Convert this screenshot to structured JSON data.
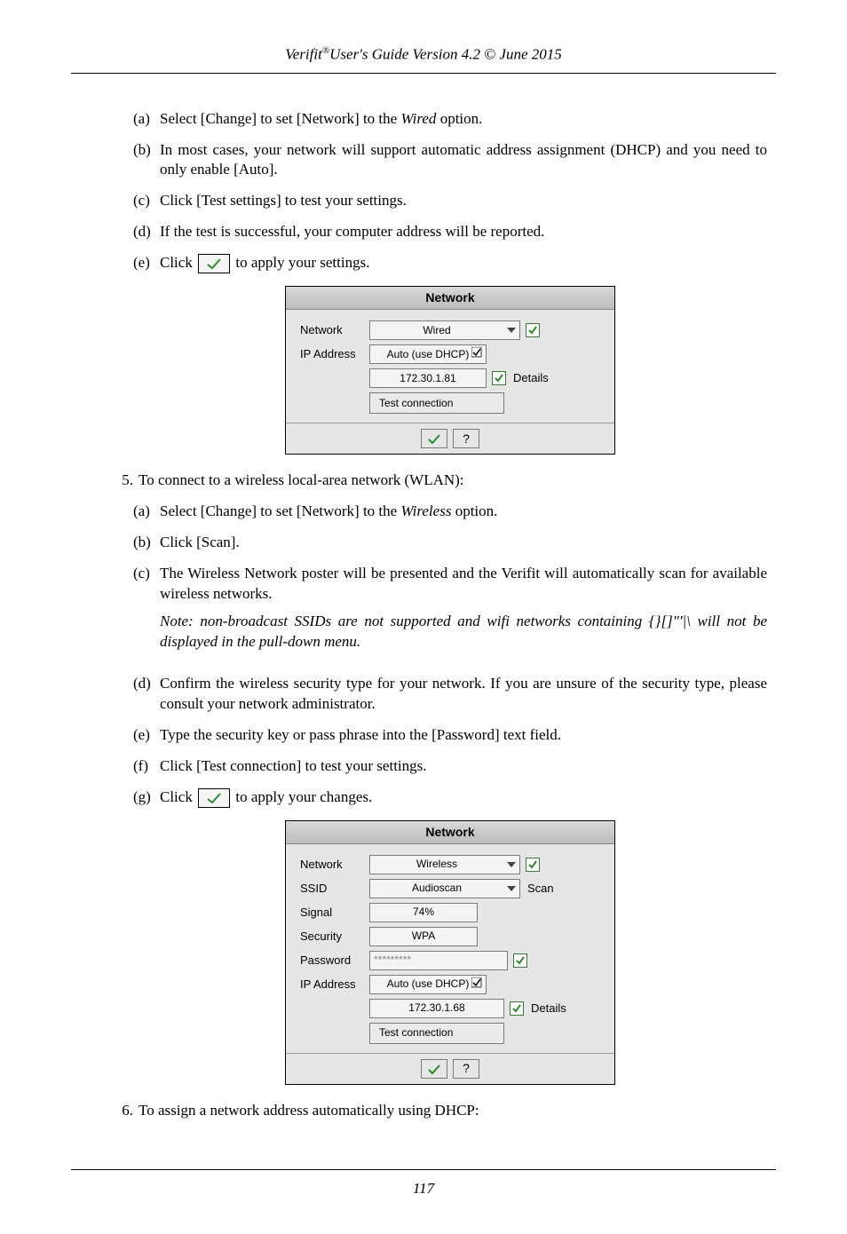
{
  "header": {
    "product": "Verifit",
    "reg": "®",
    "rest": "User's Guide Version 4.2 © June 2015"
  },
  "section4": {
    "a": {
      "m": "(a)",
      "pre": "Select [Change] to set  [Network] to the ",
      "it": "Wired",
      "post": " option."
    },
    "b": {
      "m": "(b)",
      "t": "In most cases, your network will support automatic address assignment (DHCP) and you need to only enable [Auto]."
    },
    "c": {
      "m": "(c)",
      "t": "Click [Test settings] to test your settings."
    },
    "d": {
      "m": "(d)",
      "t": "If the test is successful, your computer address will be reported."
    },
    "e": {
      "m": "(e)",
      "pre": "Click ",
      "post": " to apply your settings."
    }
  },
  "dialog1": {
    "title": "Network",
    "rows": {
      "network": {
        "label": "Network",
        "value": "Wired"
      },
      "ip": {
        "label": "IP Address",
        "value": "Auto (use DHCP)"
      },
      "ipval": {
        "value": "172.30.1.81",
        "details": "Details"
      },
      "test": "Test connection"
    },
    "help": "?"
  },
  "step5": {
    "num": "5.",
    "t": "To connect to a wireless local-area network (WLAN):",
    "a": {
      "m": "(a)",
      "pre": "Select [Change] to set  [Network] to the ",
      "it": "Wireless",
      "post": " option."
    },
    "b": {
      "m": "(b)",
      "t": "Click [Scan]."
    },
    "c": {
      "m": "(c)",
      "t": "The Wireless Network poster will be presented and the Verifit will automatically scan for available wireless networks."
    },
    "note": "Note: non-broadcast SSIDs are not supported and wifi networks containing {}[]\"'|\\ will not be displayed in the pull-down menu.",
    "d": {
      "m": "(d)",
      "t": "Confirm the wireless security type for your network. If you are unsure of the security type, please consult your network administrator."
    },
    "e": {
      "m": "(e)",
      "t": "Type the security key or pass phrase into the [Password] text field."
    },
    "f": {
      "m": "(f)",
      "t": "Click [Test connection] to test your settings."
    },
    "g": {
      "m": "(g)",
      "pre": "Click ",
      "post": " to apply your changes."
    }
  },
  "dialog2": {
    "title": "Network",
    "rows": {
      "network": {
        "label": "Network",
        "value": "Wireless"
      },
      "ssid": {
        "label": "SSID",
        "value": "Audioscan",
        "scan": "Scan"
      },
      "signal": {
        "label": "Signal",
        "value": "74%"
      },
      "security": {
        "label": "Security",
        "value": "WPA"
      },
      "password": {
        "label": "Password",
        "value": "*********"
      },
      "ip": {
        "label": "IP Address",
        "value": "Auto (use DHCP)"
      },
      "ipval": {
        "value": "172.30.1.68",
        "details": "Details"
      },
      "test": "Test connection"
    },
    "help": "?"
  },
  "step6": {
    "num": "6.",
    "t": "To assign a network address automatically using DHCP:"
  },
  "page_number": "117"
}
